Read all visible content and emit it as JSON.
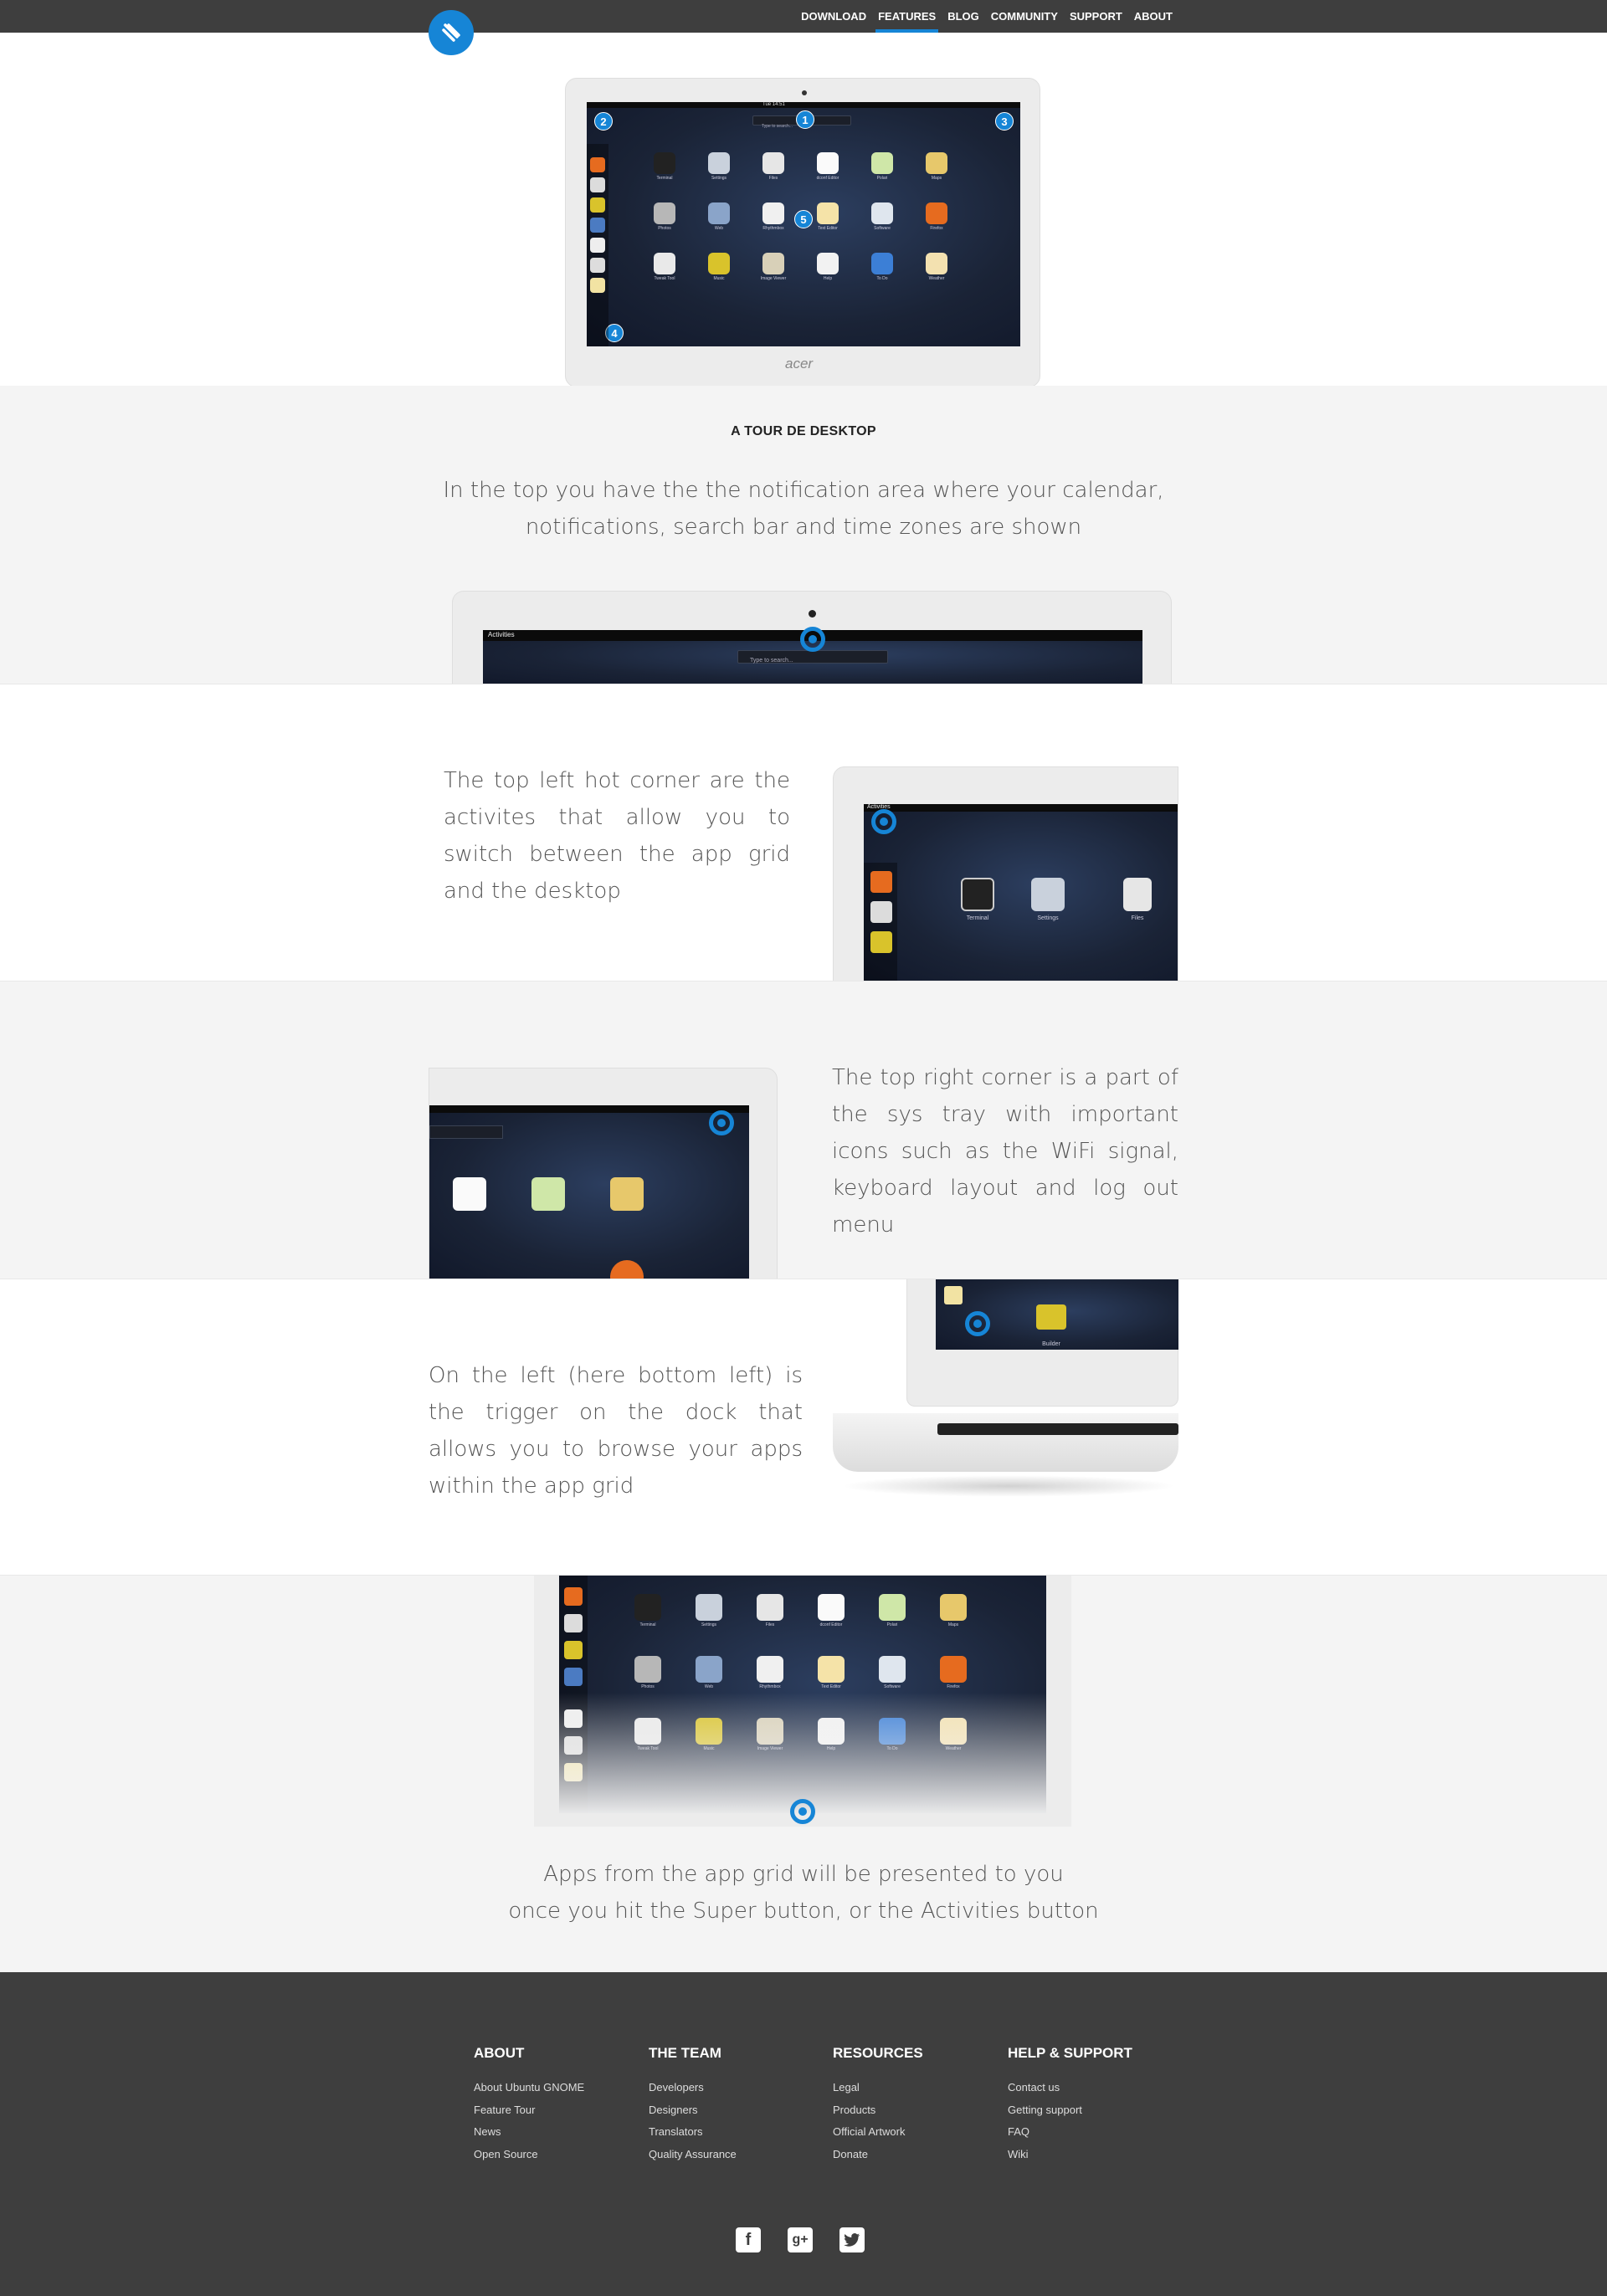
{
  "nav": {
    "items": [
      "DOWNLOAD",
      "FEATURES",
      "BLOG",
      "COMMUNITY",
      "SUPPORT",
      "ABOUT"
    ],
    "active": "FEATURES",
    "accent": "#1685d6",
    "bar_color": "#3e3e3e"
  },
  "hero": {
    "brand": "acer",
    "search_placeholder": "Type to search...",
    "clock": "Tue 14:51",
    "markers": [
      "1",
      "2",
      "3",
      "4",
      "5"
    ],
    "apps": [
      "Terminal",
      "Settings",
      "Files",
      "dconf Editor",
      "Polari",
      "Maps",
      "Photos",
      "Web",
      "Rhythmbox",
      "Text Editor",
      "Software",
      "Firefox",
      "Tweak Tool",
      "Music",
      "Image Viewer",
      "Help",
      "To Do",
      "Weather"
    ]
  },
  "tour": {
    "title": "A TOUR DE DESKTOP",
    "intro_line1": "In the top you have the the notification area where your calendar,",
    "intro_line2": "notifications, search bar and time zones are shown",
    "activities_label": "Activities",
    "search_placeholder": "Type to search...",
    "hot_corner_text": "The top left hot corner are the activites that allow you to switch between the app grid and the desktop",
    "systray_text": "The top right corner is a part of the sys tray with important icons such as the WiFi signal, keyboard layout and log out menu",
    "dock_text": "On the left (here bottom left) is the trigger on the dock that allows you to browse your apps within the app grid",
    "apps_line1": "Apps from the app grid will be presented to you",
    "apps_line2": "once you hit the Super button, or the Activities button",
    "builder_label": "Builder"
  },
  "footer": {
    "columns": [
      {
        "title": "ABOUT",
        "links": [
          "About Ubuntu GNOME",
          "Feature Tour",
          "News",
          "Open Source"
        ]
      },
      {
        "title": "THE TEAM",
        "links": [
          "Developers",
          "Designers",
          "Translators",
          "Quality Assurance"
        ]
      },
      {
        "title": "RESOURCES",
        "links": [
          "Legal",
          "Products",
          "Official Artwork",
          "Donate"
        ]
      },
      {
        "title": "HELP & SUPPORT",
        "links": [
          "Contact us",
          "Getting support",
          "FAQ",
          "Wiki"
        ]
      }
    ],
    "social": [
      "facebook-icon",
      "google-plus-icon",
      "twitter-icon"
    ]
  }
}
